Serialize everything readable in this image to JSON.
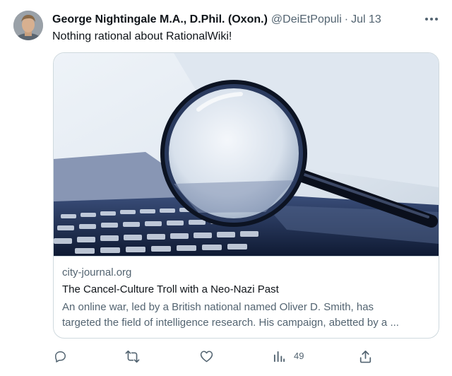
{
  "tweet": {
    "author": {
      "display_name": "George Nightingale M.A., D.Phil. (Oxon.)",
      "handle": "@DeiEtPopuli",
      "separator": "·",
      "date": "Jul 13"
    },
    "text": "Nothing rational about RationalWiki!",
    "card": {
      "domain": "city-journal.org",
      "title": "The Cancel-Culture Troll with a Neo-Nazi Past",
      "description_line1": "An online war, led by a British national named Oliver D. Smith, has",
      "description_line2": "targeted the field of intelligence research. His campaign, abetted by a ..."
    },
    "actions": {
      "reply_icon": "reply-icon",
      "retweet_icon": "retweet-icon",
      "like_icon": "heart-icon",
      "views_icon": "analytics-icon",
      "views_count": "49",
      "share_icon": "share-icon"
    },
    "colors": {
      "text": "#0f1419",
      "secondary": "#536471",
      "border": "#cfd9de"
    }
  }
}
